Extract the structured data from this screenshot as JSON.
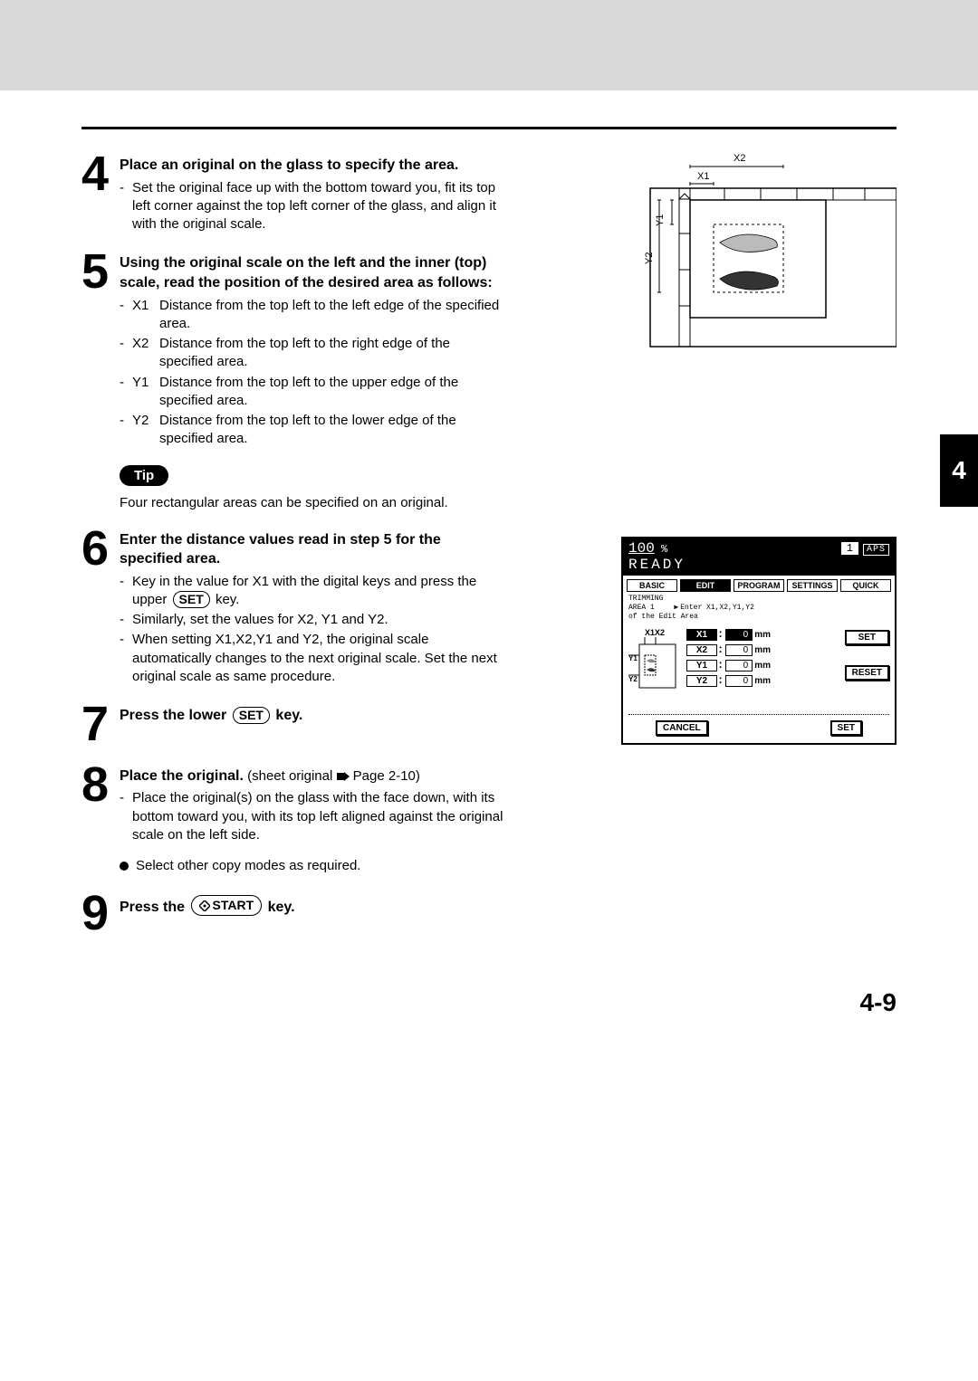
{
  "section_tab": "4",
  "page_num": "4-9",
  "step4": {
    "num": "4",
    "title": "Place an original on the glass to specify the area.",
    "bullet": "Set the original face up with the bottom toward you, fit its top left corner against the top left corner of the glass, and align it with the original scale."
  },
  "step5": {
    "num": "5",
    "title": "Using the original scale on the left and the inner (top) scale, read the position of the desired area as follows:",
    "items": [
      {
        "lbl": "X1",
        "txt": "Distance from the top left to the left edge of the specified area."
      },
      {
        "lbl": "X2",
        "txt": "Distance from the top left to the right edge of the specified area."
      },
      {
        "lbl": "Y1",
        "txt": "Distance from the top left to the upper edge of the specified area."
      },
      {
        "lbl": "Y2",
        "txt": "Distance from the top left to the lower edge of the specified area."
      }
    ]
  },
  "tip": {
    "label": "Tip",
    "text": "Four rectangular areas can be specified on an original."
  },
  "step6": {
    "num": "6",
    "title": "Enter the distance values read in step 5 for the specified area.",
    "b1a": "Key in the value for X1 with the digital keys and press the upper",
    "b1_key": "SET",
    "b1b": "key.",
    "b2": "Similarly, set the values for X2, Y1 and Y2.",
    "b3": "When setting X1,X2,Y1 and Y2, the original scale automatically changes to the next original scale.  Set the next original scale as same procedure."
  },
  "step7": {
    "num": "7",
    "t1": "Press the lower",
    "key": "SET",
    "t2": "key."
  },
  "step8": {
    "num": "8",
    "title": "Place the original.",
    "ref_a": "(sheet original",
    "ref_b": "Page 2-10)",
    "b1": "Place the original(s) on the glass with the face down, with its bottom toward you, with its top left aligned against the original scale on the left side.",
    "extra": "Select other copy modes as required."
  },
  "step9": {
    "num": "9",
    "t1": "Press the",
    "key": "START",
    "t2": "key."
  },
  "scanner_labels": {
    "x1": "X1",
    "x2": "X2",
    "y1": "Y1",
    "y2": "Y2"
  },
  "panel": {
    "zoom": "100",
    "pct": "%",
    "count": "1",
    "aps": "APS",
    "ready": "READY",
    "tabs": [
      "BASIC",
      "EDIT",
      "PROGRAM",
      "SETTINGS",
      "QUICK"
    ],
    "active_tab": 1,
    "mode": "TRIMMING\nAREA 1",
    "msg": "Enter X1,X2,Y1,Y2\nof the Edit Area",
    "diag_labels": {
      "top": "X1X2",
      "y1": "Y1",
      "y2": "Y2"
    },
    "rows": [
      {
        "lbl": "X1",
        "val": "0",
        "unit": "mm",
        "active": true
      },
      {
        "lbl": "X2",
        "val": "0",
        "unit": "mm",
        "active": false
      },
      {
        "lbl": "Y1",
        "val": "0",
        "unit": "mm",
        "active": false
      },
      {
        "lbl": "Y2",
        "val": "0",
        "unit": "mm",
        "active": false
      }
    ],
    "btn_set_upper": "SET",
    "btn_reset": "RESET",
    "btn_cancel": "CANCEL",
    "btn_set_lower": "SET"
  }
}
